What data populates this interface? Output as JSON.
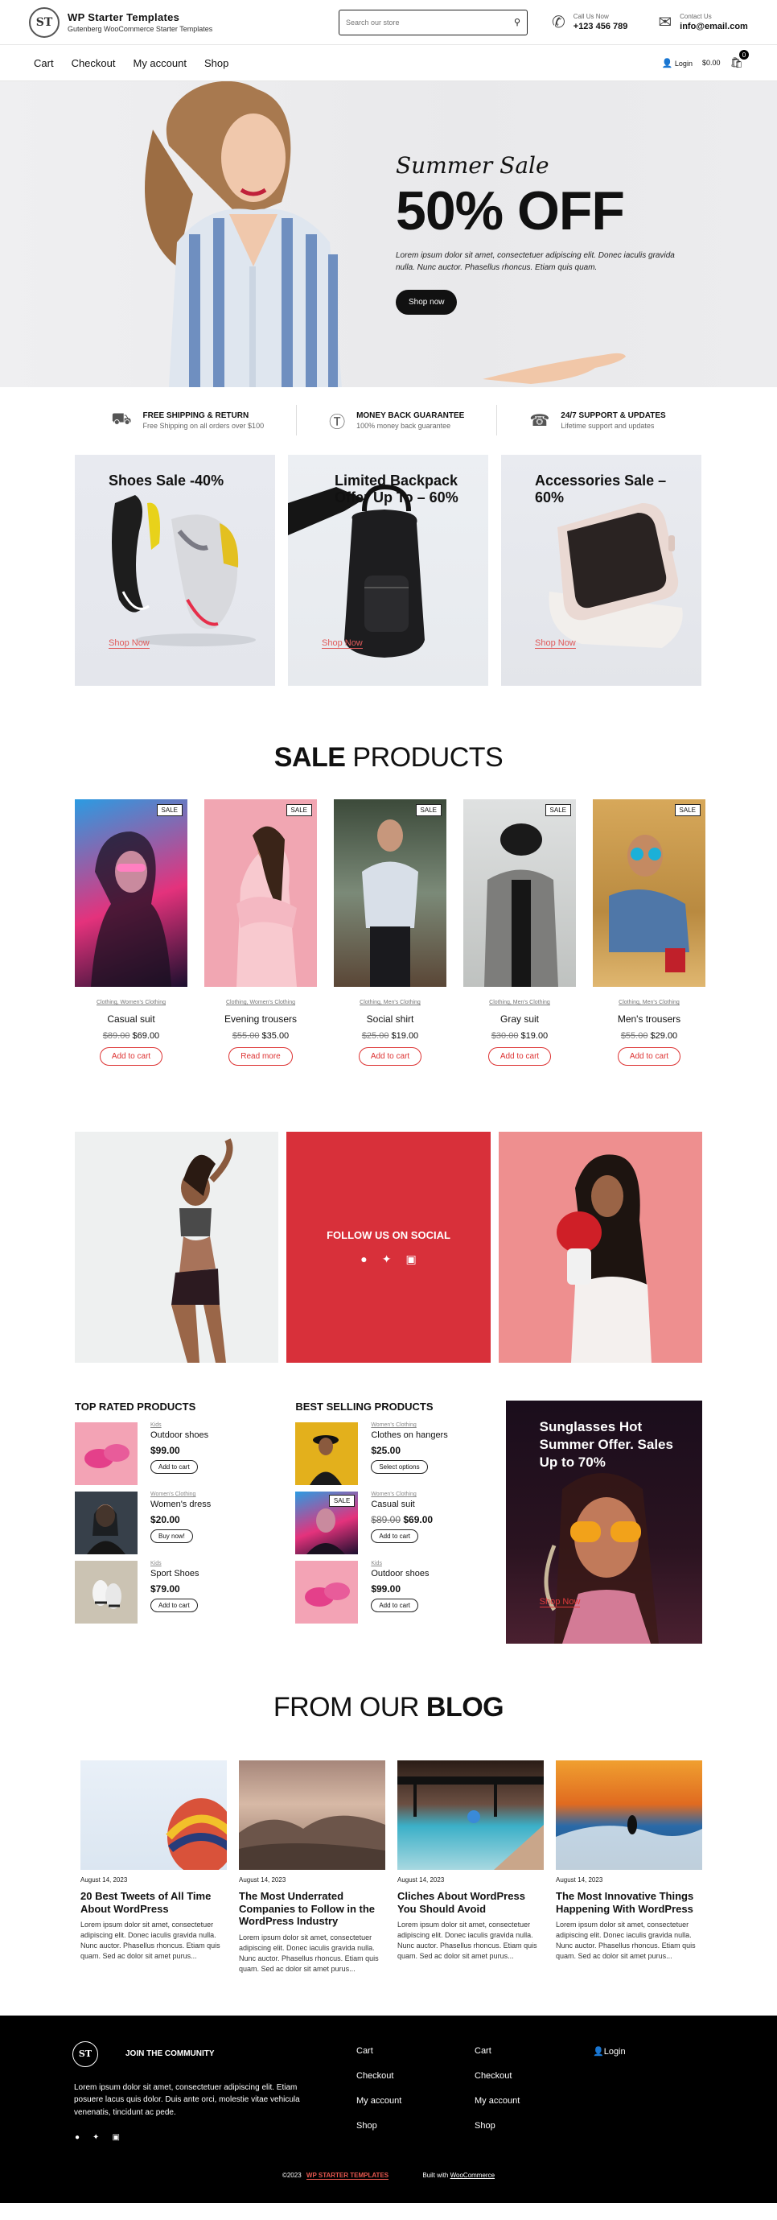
{
  "header": {
    "logo_mark": "ST",
    "site_title": "WP Starter Templates",
    "site_tagline": "Gutenberg WooCommerce Starter Templates",
    "search_placeholder": "Search our store",
    "call_label": "Call Us Now",
    "call_value": "+123 456 789",
    "contact_label": "Contact Us",
    "contact_value": "info@email.com"
  },
  "nav": {
    "items": [
      "Cart",
      "Checkout",
      "My account",
      "Shop"
    ],
    "login": "Login",
    "cart_total": "$0.00",
    "cart_count": "0"
  },
  "hero": {
    "pre": "Summer Sale",
    "big": "50% OFF",
    "desc": "Lorem ipsum dolor sit amet, consectetuer adipiscing elit. Donec iaculis gravida nulla. Nunc auctor. Phasellus rhoncus. Etiam quis quam.",
    "button": "Shop now"
  },
  "features": [
    {
      "title": "FREE SHIPPING & RETURN",
      "desc": "Free Shipping on all orders over $100",
      "icon": "truck-icon"
    },
    {
      "title": "MONEY BACK GUARANTEE",
      "desc": "100% money back guarantee",
      "icon": "dollar-icon"
    },
    {
      "title": "24/7 SUPPORT & UPDATES",
      "desc": "Lifetime support and updates",
      "icon": "support-icon"
    }
  ],
  "promos": [
    {
      "title": "Shoes Sale -40%",
      "link": "Shop Now"
    },
    {
      "title": "Limited Backpack Offer Up To – 60%",
      "link": "Shop Now"
    },
    {
      "title": "Accessories Sale – 60%",
      "link": "Shop Now"
    }
  ],
  "sale_section": {
    "bold": "SALE",
    "light": "PRODUCTS"
  },
  "sale_products": [
    {
      "badge": "SALE",
      "cat": "Clothing, Women's Clothing",
      "name": "Casual suit",
      "old": "$89.00",
      "price": "$69.00",
      "button": "Add to cart"
    },
    {
      "badge": "SALE",
      "cat": "Clothing, Women's Clothing",
      "name": "Evening trousers",
      "old": "$55.00",
      "price": "$35.00",
      "button": "Read more"
    },
    {
      "badge": "SALE",
      "cat": "Clothing, Men's Clothing",
      "name": "Social shirt",
      "old": "$25.00",
      "price": "$19.00",
      "button": "Add to cart"
    },
    {
      "badge": "SALE",
      "cat": "Clothing, Men's Clothing",
      "name": "Gray suit",
      "old": "$30.00",
      "price": "$19.00",
      "button": "Add to cart"
    },
    {
      "badge": "SALE",
      "cat": "Clothing, Men's Clothing",
      "name": "Men's trousers",
      "old": "$55.00",
      "price": "$29.00",
      "button": "Add to cart"
    }
  ],
  "social": {
    "title": "FOLLOW US ON SOCIAL"
  },
  "top_rated": {
    "title": "TOP RATED PRODUCTS",
    "items": [
      {
        "cat": "Kids",
        "name": "Outdoor shoes",
        "price": "$99.00",
        "old": "",
        "button": "Add to cart"
      },
      {
        "cat": "Women's Clothing",
        "name": "Women's dress",
        "price": "$20.00",
        "old": "",
        "button": "Buy now!"
      },
      {
        "cat": "Kids",
        "name": "Sport Shoes",
        "price": "$79.00",
        "old": "",
        "button": "Add to cart"
      }
    ]
  },
  "best_selling": {
    "title": "BEST SELLING PRODUCTS",
    "items": [
      {
        "cat": "Women's Clothing",
        "name": "Clothes on hangers",
        "price": "$25.00",
        "old": "",
        "button": "Select options",
        "badge": ""
      },
      {
        "cat": "Women's Clothing",
        "name": "Casual suit",
        "price": "$69.00",
        "old": "$89.00",
        "button": "Add to cart",
        "badge": "SALE"
      },
      {
        "cat": "Kids",
        "name": "Outdoor shoes",
        "price": "$99.00",
        "old": "",
        "button": "Add to cart",
        "badge": ""
      }
    ]
  },
  "sunglasses": {
    "title": "Sunglasses Hot Summer Offer. Sales Up to 70%",
    "link": "Shop Now"
  },
  "blog_section": {
    "light": "FROM OUR",
    "bold": "BLOG"
  },
  "posts": [
    {
      "date": "August 14, 2023",
      "title": "20 Best Tweets of All Time About WordPress",
      "excerpt": "Lorem ipsum dolor sit amet, consectetuer adipiscing elit. Donec iaculis gravida nulla. Nunc auctor. Phasellus rhoncus. Etiam quis quam. Sed ac dolor sit amet purus..."
    },
    {
      "date": "August 14, 2023",
      "title": "The Most Underrated Companies to Follow in the WordPress Industry",
      "excerpt": "Lorem ipsum dolor sit amet, consectetuer adipiscing elit. Donec iaculis gravida nulla. Nunc auctor. Phasellus rhoncus. Etiam quis quam. Sed ac dolor sit amet purus..."
    },
    {
      "date": "August 14, 2023",
      "title": "Cliches About WordPress You Should Avoid",
      "excerpt": "Lorem ipsum dolor sit amet, consectetuer adipiscing elit. Donec iaculis gravida nulla. Nunc auctor. Phasellus rhoncus. Etiam quis quam. Sed ac dolor sit amet purus..."
    },
    {
      "date": "August 14, 2023",
      "title": "The Most Innovative Things Happening With WordPress",
      "excerpt": "Lorem ipsum dolor sit amet, consectetuer adipiscing elit. Donec iaculis gravida nulla. Nunc auctor. Phasellus rhoncus. Etiam quis quam. Sed ac dolor sit amet purus..."
    }
  ],
  "footer": {
    "logo_mark": "ST",
    "join": "JOIN THE COMMUNITY",
    "desc": "Lorem ipsum dolor sit amet, consectetuer adipiscing elit. Etiam posuere lacus quis dolor. Duis ante orci, molestie vitae vehicula venenatis, tincidunt ac pede.",
    "col1": [
      "Cart",
      "Checkout",
      "My account",
      "Shop"
    ],
    "col2": [
      "Cart",
      "Checkout",
      "My account",
      "Shop"
    ],
    "login": "Login",
    "copyright": "©2023",
    "brand": "WP STARTER TEMPLATES",
    "built": "Built with",
    "woo": "WooCommerce"
  },
  "colors": {
    "accent": "#d8303a",
    "dark": "#111111",
    "link_red": "#e05a5a"
  }
}
